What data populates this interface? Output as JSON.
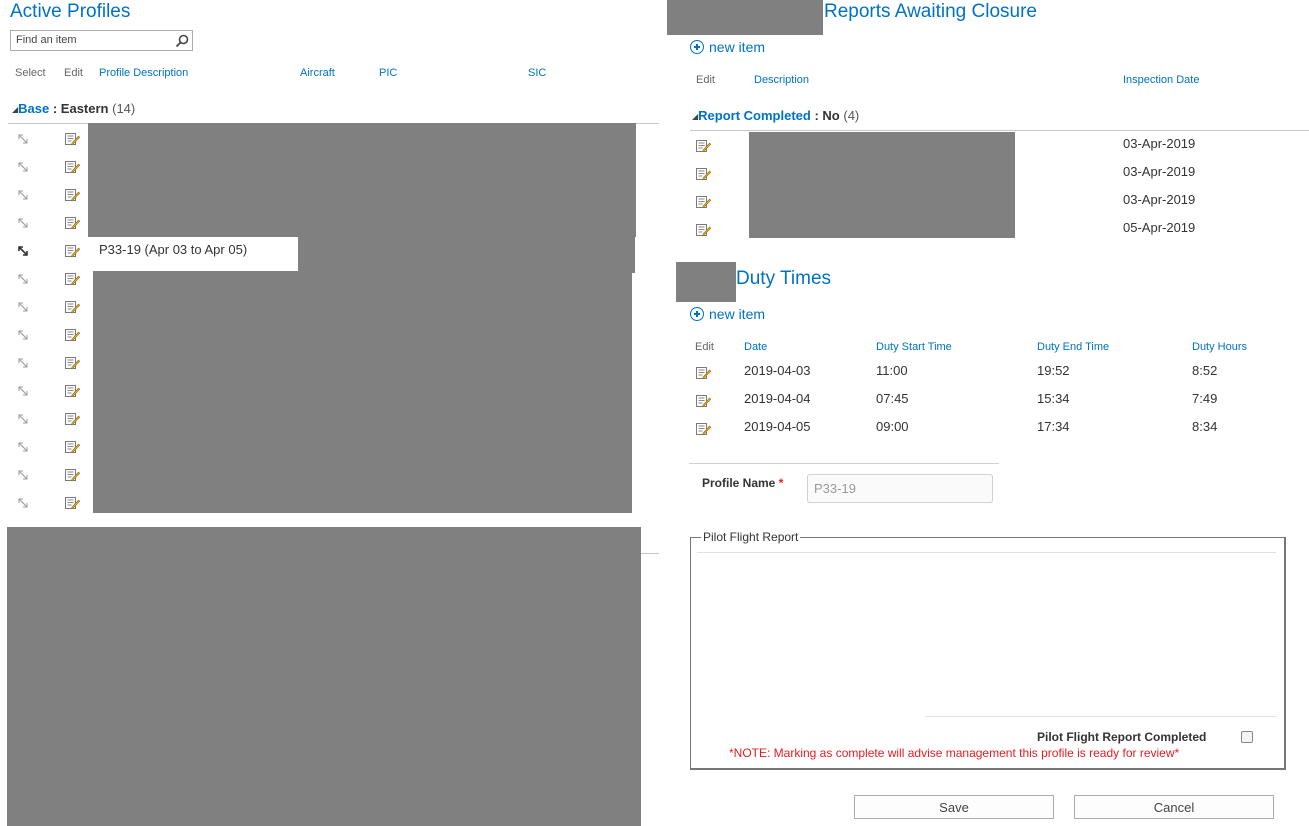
{
  "left": {
    "title": "Active Profiles",
    "search": {
      "placeholder": "Find an item"
    },
    "columns": {
      "select": "Select",
      "edit": "Edit",
      "profile_description": "Profile Description",
      "aircraft": "Aircraft",
      "pic": "PIC",
      "sic": "SIC"
    },
    "group": {
      "field": "Base",
      "separator": " : ",
      "value": "Eastern",
      "count": "(14)"
    },
    "rows": [
      {
        "description": ""
      },
      {
        "description": ""
      },
      {
        "description": ""
      },
      {
        "description": ""
      },
      {
        "description": "P33-19 (Apr 03 to Apr 05)",
        "selected": true
      },
      {
        "description": ""
      },
      {
        "description": ""
      },
      {
        "description": ""
      },
      {
        "description": ""
      },
      {
        "description": ""
      },
      {
        "description": ""
      },
      {
        "description": ""
      },
      {
        "description": ""
      },
      {
        "description": ""
      }
    ]
  },
  "reports": {
    "title": "Reports Awaiting Closure",
    "new_item": "new item",
    "columns": {
      "edit": "Edit",
      "description": "Description",
      "inspection_date": "Inspection Date"
    },
    "group": {
      "field": "Report Completed",
      "separator": " : ",
      "value": "No",
      "count": "(4)"
    },
    "rows": [
      {
        "inspection_date": "03-Apr-2019"
      },
      {
        "inspection_date": "03-Apr-2019"
      },
      {
        "inspection_date": "03-Apr-2019"
      },
      {
        "inspection_date": "05-Apr-2019"
      }
    ]
  },
  "duty": {
    "title": "Duty Times",
    "new_item": "new item",
    "columns": {
      "edit": "Edit",
      "date": "Date",
      "start": "Duty Start Time",
      "end": "Duty End Time",
      "hours": "Duty Hours"
    },
    "rows": [
      {
        "date": "2019-04-03",
        "start": "11:00",
        "end": "19:52",
        "hours": "8:52"
      },
      {
        "date": "2019-04-04",
        "start": "07:45",
        "end": "15:34",
        "hours": "7:49"
      },
      {
        "date": "2019-04-05",
        "start": "09:00",
        "end": "17:34",
        "hours": "8:34"
      }
    ]
  },
  "form": {
    "profile_name_label": "Profile Name",
    "required_marker": "*",
    "profile_name_value": "P33-19",
    "fieldset_legend": "Pilot Flight Report",
    "completed_label": "Pilot Flight Report Completed",
    "note": "*NOTE: Marking as complete will advise management this profile is ready for review*",
    "save": "Save",
    "cancel": "Cancel"
  },
  "colors": {
    "link_blue": "#0072c6",
    "note_red": "#e51c23",
    "redaction_gray": "#808080"
  }
}
